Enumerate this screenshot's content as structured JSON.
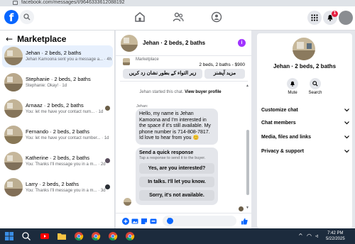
{
  "browser": {
    "url": "facebook.com/messages/t/9646333612088192"
  },
  "topbar": {
    "logo_letter": "f",
    "notification_count": "1"
  },
  "sidebar": {
    "title": "Marketplace",
    "threads": [
      {
        "name": "Jehan · 2 beds, 2 baths",
        "preview": "Jehan Kamoona sent you a message a... · 4h",
        "active": true
      },
      {
        "name": "Stephanie · 2 beds, 2 baths",
        "preview": "Stephanie: Okay! · 1d",
        "active": false
      },
      {
        "name": "Arnaaz · 2 beds, 2 baths",
        "preview": "You: let me have your contact num... · 1d",
        "active": false
      },
      {
        "name": "Fernando · 2 beds, 2 baths",
        "preview": "You: let me have your contact number... · 1d",
        "active": false
      },
      {
        "name": "Katherine · 2 beds, 2 baths",
        "preview": "You: Thanks I'll message you in a m... · 2d",
        "active": false
      },
      {
        "name": "Larry · 2 beds, 2 baths",
        "preview": "You: Thanks I'll message you in a m... · 3d",
        "active": false
      }
    ]
  },
  "chat": {
    "title": "Jehan · 2 beds, 2 baths",
    "listing": {
      "label": "Marketplace",
      "title": "2 beds, 2 baths - $900",
      "btn_left": "زیر التواء کے بطور نشان زد کریں",
      "btn_right": "مزید آپشنز"
    },
    "system_text": "Jehan started this chat.",
    "system_link": "View buyer profile",
    "sender_label": "Jehan:",
    "message": "Hello, my name is Jehan Kamoona and I'm interested in the space if it's still available. My phone number is 714-808-7817. Id love to hear from you 😊",
    "quick_reply": {
      "title": "Send a quick response",
      "subtitle": "Tap a response to send it to the buyer.",
      "options": [
        "Yes, are you interested?",
        "In talks. I'll let you know.",
        "Sorry, it's not available."
      ]
    },
    "composer_placeholder": "Aa"
  },
  "details": {
    "name": "Jehan · 2 beds, 2 baths",
    "actions": [
      {
        "label": "Mute",
        "icon": "bell-icon"
      },
      {
        "label": "Search",
        "icon": "search-icon"
      }
    ],
    "sections": [
      "Customize chat",
      "Chat members",
      "Media, files and links",
      "Privacy & support"
    ]
  },
  "taskbar": {
    "time": "7:42 PM",
    "date": "5/22/2025"
  },
  "colors": {
    "brand": "#0866ff",
    "active_thread": "#e7f0fd",
    "taskbar": "#1c2b3d",
    "badge": "#e41e3f"
  }
}
